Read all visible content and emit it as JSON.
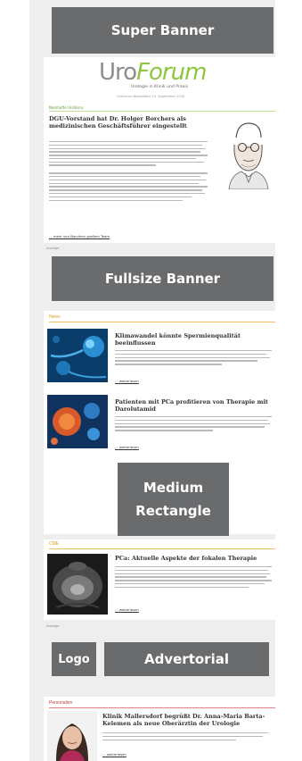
{
  "banners": {
    "super": "Super Banner",
    "fullsize": "Fullsize Banner",
    "medium_line1": "Medium",
    "medium_line2": "Rectangle",
    "logo": "Logo",
    "advertorial": "Advertorial"
  },
  "brand": {
    "uro": "Uro",
    "forum": "Forum",
    "tagline": "Urologie in Klinik und Praxis",
    "newsletter_line": "UroForum Newsletter 23. September 2020",
    "color_gray": "#8c8d8f",
    "color_green": "#8ec63f"
  },
  "top_story": {
    "section": "Namhafte UroStory",
    "headline": "DGU-Vorstand hat Dr. Holger Borchers als medizinischen Geschäftsführer eingestellt",
    "more": "... mehr von Borchers großem Team"
  },
  "anzeige_1": "Anzeige",
  "news": {
    "section": "News",
    "items": [
      {
        "headline": "Klimawandel könnte Spermienqualität beeinflussen",
        "more": "... weiterlesen"
      },
      {
        "headline": "Patienten mit PCa profitieren von Therapie mit Darolutamid",
        "more": "... weiterlesen"
      }
    ]
  },
  "cme": {
    "section": "CME",
    "headline": "PCa: Aktuelle Aspekte der fokalen Therapie",
    "more": "... weiterlesen"
  },
  "anzeige_2": "Anzeige",
  "personalien": {
    "section": "Personalien",
    "headline": "Klinik Mallersdorf begrüßt Dr. Anna-Maria Barta-Kelemen als neue Oberärztin der Urologie",
    "more": "... weiterlesen"
  }
}
